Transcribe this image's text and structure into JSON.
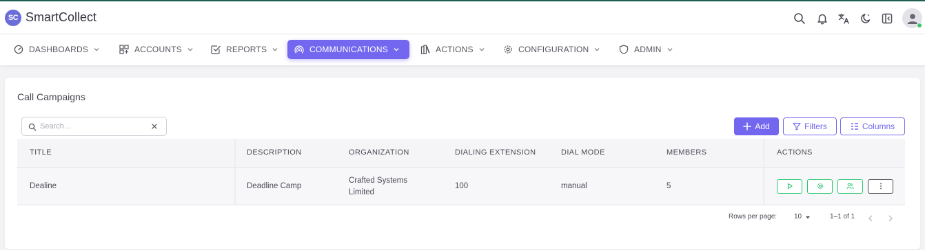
{
  "app": {
    "logo_text": "SC",
    "brand": "SmartCollect",
    "top_icons": [
      "search-icon",
      "bell-icon",
      "translate-icon",
      "dark-mode-icon",
      "collapse-sidebar-icon",
      "user-avatar-icon"
    ]
  },
  "nav": {
    "items": [
      {
        "label": "DASHBOARDS",
        "icon": "gauge-icon"
      },
      {
        "label": "ACCOUNTS",
        "icon": "grid-plus-icon"
      },
      {
        "label": "REPORTS",
        "icon": "checkbox-icon"
      },
      {
        "label": "COMMUNICATIONS",
        "icon": "broadcast-icon",
        "active": true
      },
      {
        "label": "ACTIONS",
        "icon": "books-icon"
      },
      {
        "label": "CONFIGURATION",
        "icon": "gear-icon"
      },
      {
        "label": "ADMIN",
        "icon": "shield-icon"
      }
    ]
  },
  "page": {
    "title": "Call Campaigns",
    "search_placeholder": "Search...",
    "buttons": {
      "add": "Add",
      "filters": "Filters",
      "columns": "Columns"
    }
  },
  "table": {
    "headers": [
      "TITLE",
      "DESCRIPTION",
      "ORGANIZATION",
      "DIALING EXTENSION",
      "DIAL MODE",
      "MEMBERS",
      "ACTIONS"
    ],
    "rows": [
      {
        "title": "Dealine",
        "description": "Deadline Camp",
        "organization_line1": "Crafted Systems",
        "organization_line2": "Limited",
        "dialing_extension": "100",
        "dial_mode": "manual",
        "members": "5"
      }
    ]
  },
  "pagination": {
    "rows_per_page_label": "Rows per page:",
    "rows_per_page_value": "10",
    "range": "1–1 of 1"
  },
  "colors": {
    "primary": "#7367f0",
    "success": "#28c76f",
    "header_border": "#1f5f52"
  }
}
